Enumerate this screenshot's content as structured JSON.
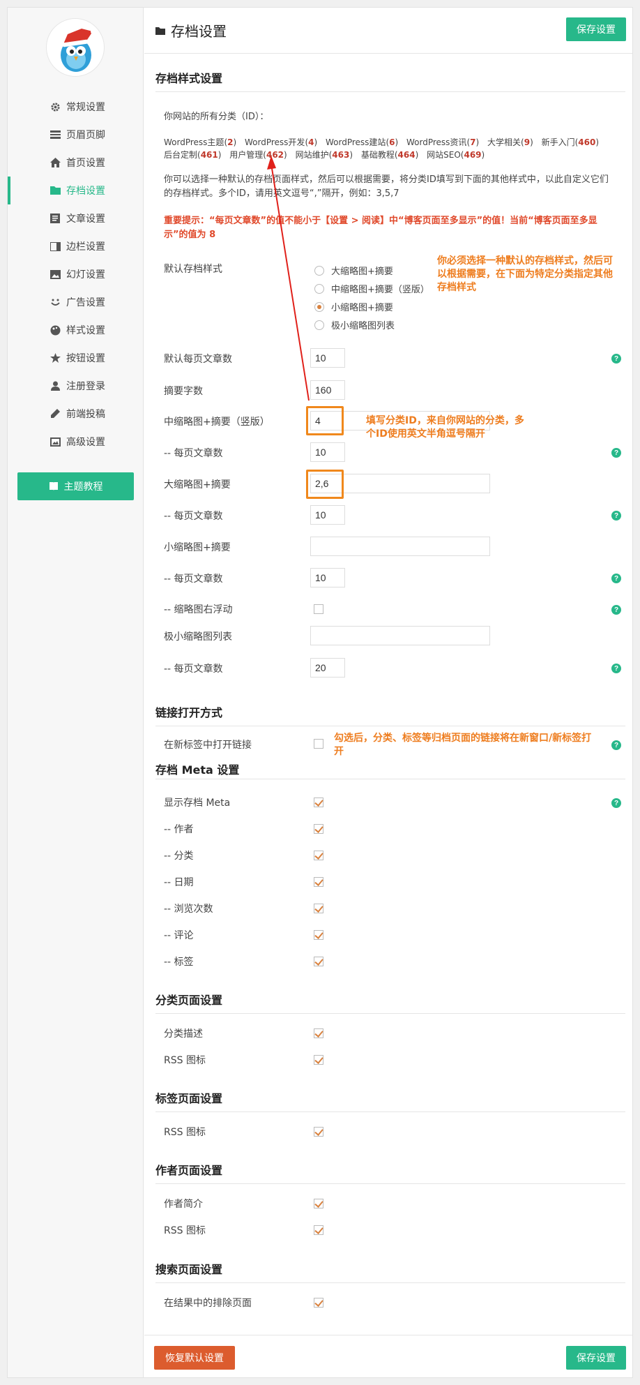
{
  "sidebar": {
    "items": [
      {
        "label": "常规设置",
        "icon": "gear-icon"
      },
      {
        "label": "页眉页脚",
        "icon": "header-icon"
      },
      {
        "label": "首页设置",
        "icon": "home-icon"
      },
      {
        "label": "存档设置",
        "icon": "folder-icon",
        "active": true
      },
      {
        "label": "文章设置",
        "icon": "document-icon"
      },
      {
        "label": "边栏设置",
        "icon": "sidebar-icon"
      },
      {
        "label": "幻灯设置",
        "icon": "slides-icon"
      },
      {
        "label": "广告设置",
        "icon": "smile-icon"
      },
      {
        "label": "样式设置",
        "icon": "palette-icon"
      },
      {
        "label": "按钮设置",
        "icon": "star-icon"
      },
      {
        "label": "注册登录",
        "icon": "user-icon"
      },
      {
        "label": "前端投稿",
        "icon": "pencil-icon"
      },
      {
        "label": "高级设置",
        "icon": "image-icon"
      }
    ],
    "tutorial_label": "主题教程"
  },
  "header": {
    "title": "存档设置",
    "save_label": "保存设置"
  },
  "archive_style": {
    "section_title": "存档样式设置",
    "categories_intro": "你网站的所有分类（ID）：",
    "categories": [
      {
        "name": "WordPress主题",
        "id": "2"
      },
      {
        "name": "WordPress开发",
        "id": "4"
      },
      {
        "name": "WordPress建站",
        "id": "6"
      },
      {
        "name": "WordPress资讯",
        "id": "7"
      },
      {
        "name": "大学相关",
        "id": "9"
      },
      {
        "name": "新手入门",
        "id": "460"
      },
      {
        "name": "后台定制",
        "id": "461"
      },
      {
        "name": "用户管理",
        "id": "462"
      },
      {
        "name": "网站维护",
        "id": "463"
      },
      {
        "name": "基础教程",
        "id": "464"
      },
      {
        "name": "网站SEO",
        "id": "469"
      }
    ],
    "description": "你可以选择一种默认的存档页面样式，然后可以根据需要，将分类ID填写到下面的其他样式中，以此自定义它们的存档样式。多个ID，请用英文逗号“,”隔开，例如：3,5,7",
    "warning": "重要提示：“每页文章数”的值不能小于【设置 > 阅读】中“博客页面至多显示”的值！当前“博客页面至多显示”的值为 8",
    "default_style_label": "默认存档样式",
    "style_options": [
      "大缩略图+摘要",
      "中缩略图+摘要（竖版）",
      "小缩略图+摘要",
      "极小缩略图列表"
    ],
    "selected_style": "小缩略图+摘要",
    "default_per_page_label": "默认每页文章数",
    "default_per_page_value": "10",
    "excerpt_label": "摘要字数",
    "excerpt_value": "160",
    "medium_label": "中缩略图+摘要（竖版）",
    "medium_value": "4",
    "medium_per_page_label": "-- 每页文章数",
    "medium_per_page_value": "10",
    "large_label": "大缩略图+摘要",
    "large_value": "2,6",
    "large_per_page_label": "-- 每页文章数",
    "large_per_page_value": "10",
    "small_label": "小缩略图+摘要",
    "small_value": "",
    "small_per_page_label": "-- 每页文章数",
    "small_per_page_value": "10",
    "float_label": "-- 缩略图右浮动",
    "tiny_label": "极小缩略图列表",
    "tiny_value": "",
    "tiny_per_page_label": "-- 每页文章数",
    "tiny_per_page_value": "20"
  },
  "annotations": {
    "note_default": "你必须选择一种默认的存档样式，然后可以根据需要，在下面为特定分类指定其他存档样式",
    "note_ids": "填写分类ID，来自你网站的分类，多个ID使用英文半角逗号隔开",
    "note_link": "勾选后，分类、标签等归档页面的链接将在新窗口/新标签打开"
  },
  "link_open": {
    "section_title": "链接打开方式",
    "new_tab_label": "在新标签中打开链接"
  },
  "meta": {
    "section_title": "存档 Meta 设置",
    "items": [
      "显示存档 Meta",
      "-- 作者",
      "-- 分类",
      "-- 日期",
      "-- 浏览次数",
      "-- 评论",
      "-- 标签"
    ]
  },
  "category_page": {
    "section_title": "分类页面设置",
    "items": [
      "分类描述",
      "RSS 图标"
    ]
  },
  "tag_page": {
    "section_title": "标签页面设置",
    "items": [
      "RSS 图标"
    ]
  },
  "author_page": {
    "section_title": "作者页面设置",
    "items": [
      "作者简介",
      "RSS 图标"
    ]
  },
  "search_page": {
    "section_title": "搜索页面设置",
    "items": [
      "在结果中的排除页面"
    ]
  },
  "footer": {
    "reset_label": "恢复默认设置",
    "save_label": "保存设置"
  },
  "help_glyph": "?",
  "colors": {
    "accent": "#27b88a",
    "danger": "#dc5c2e",
    "annotation": "#ee7d1f",
    "arrow": "#e0201a"
  }
}
